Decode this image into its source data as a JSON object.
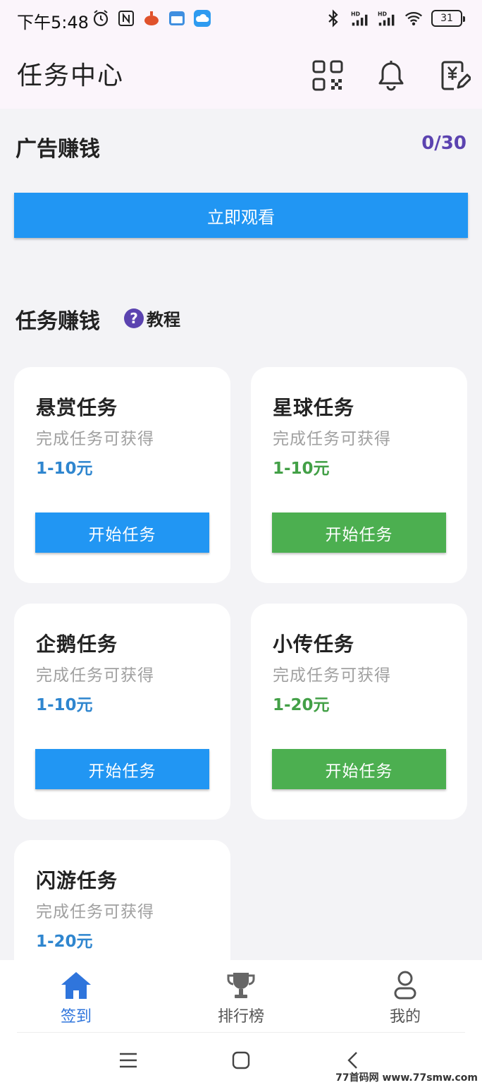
{
  "status_bar": {
    "time": "下午5:48",
    "battery": "31",
    "icons": [
      "alarm-icon",
      "nfc-icon",
      "app-icon",
      "calendar-icon",
      "cloud-icon",
      "bluetooth-icon",
      "signal-hd-icon",
      "signal-hd-icon",
      "wifi-icon"
    ]
  },
  "header": {
    "title": "任务中心",
    "actions": [
      "qr-code-icon",
      "bell-icon",
      "yuan-edit-icon"
    ]
  },
  "ad_section": {
    "title": "广告赚钱",
    "counter": "0/30",
    "button_label": "立即观看"
  },
  "task_section": {
    "title": "任务赚钱",
    "help_icon": "?",
    "tutorial_label": "教程"
  },
  "tasks": [
    {
      "title": "悬赏任务",
      "subtitle": "完成任务可获得",
      "reward": "1-10元",
      "button": "开始任务",
      "color": "#2196f3"
    },
    {
      "title": "星球任务",
      "subtitle": "完成任务可获得",
      "reward": "1-10元",
      "button": "开始任务",
      "color": "#4caf50"
    },
    {
      "title": "企鹅任务",
      "subtitle": "完成任务可获得",
      "reward": "1-10元",
      "button": "开始任务",
      "color": "#2196f3"
    },
    {
      "title": "小传任务",
      "subtitle": "完成任务可获得",
      "reward": "1-20元",
      "button": "开始任务",
      "color": "#4caf50"
    },
    {
      "title": "闪游任务",
      "subtitle": "完成任务可获得",
      "reward": "1-20元",
      "color": "#2f86cf"
    }
  ],
  "bottom_nav": [
    {
      "label": "签到",
      "icon": "home-icon",
      "active": true
    },
    {
      "label": "排行榜",
      "icon": "trophy-icon",
      "active": false
    },
    {
      "label": "我的",
      "icon": "person-icon",
      "active": false
    }
  ],
  "watermark": "77首码网 www.77smw.com",
  "colors": {
    "primary": "#2196f3",
    "green": "#4caf50",
    "accent": "#5b43b0",
    "nav_active": "#2f75dc"
  }
}
